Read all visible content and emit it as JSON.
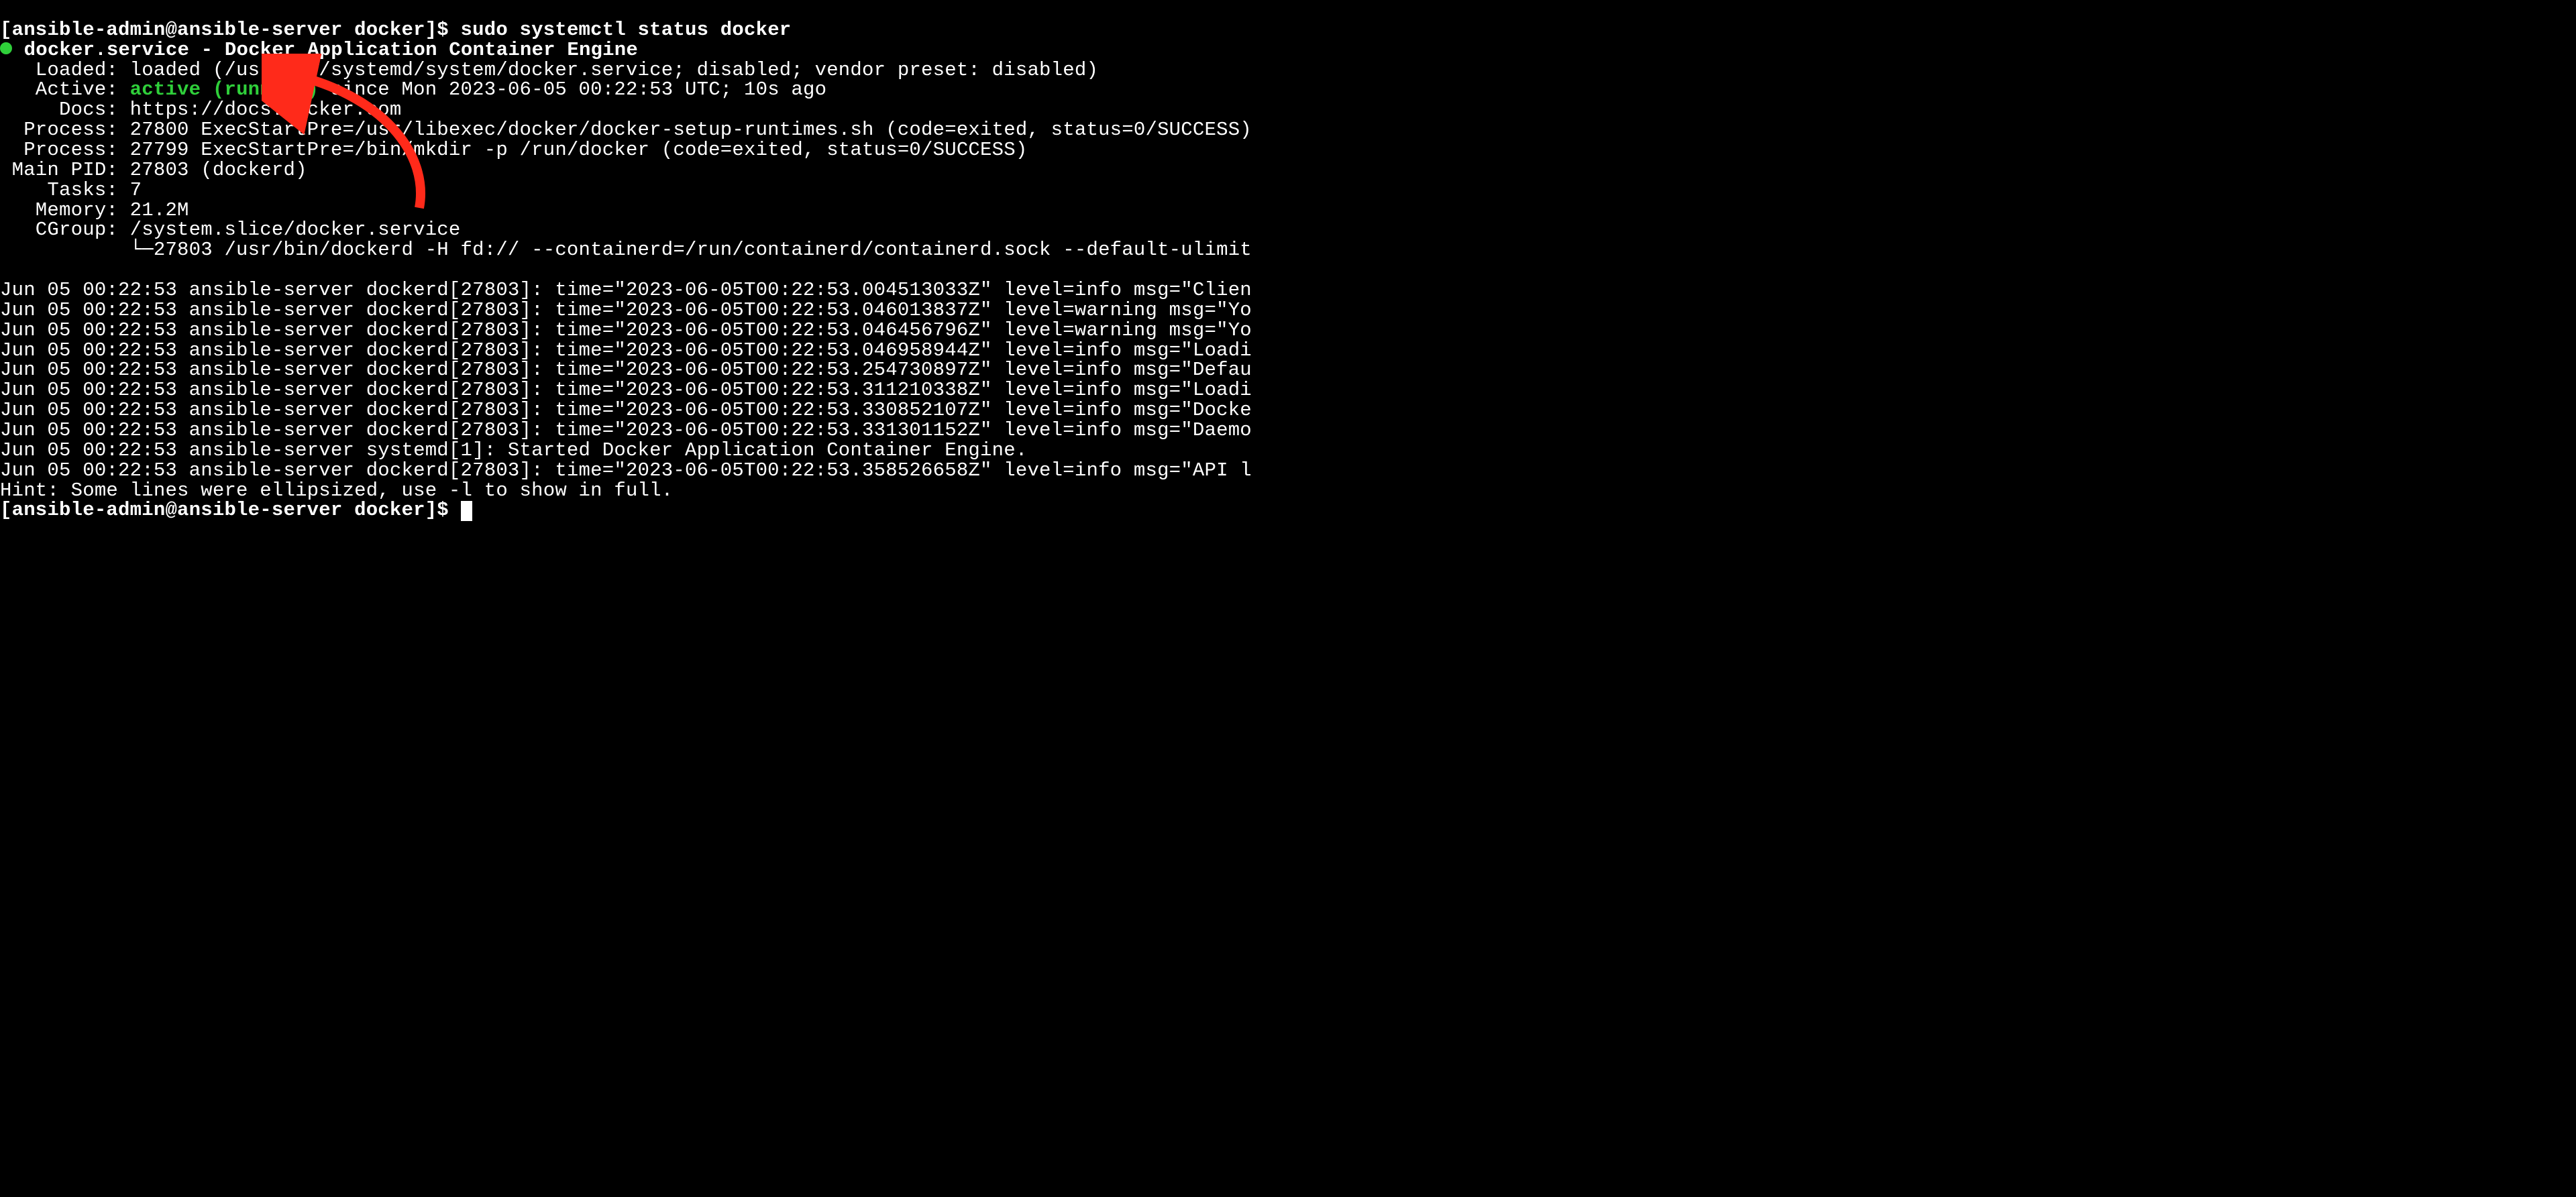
{
  "prompt1": "[ansible-admin@ansible-server docker]$ ",
  "cmd1": "sudo systemctl status docker",
  "dot_gap": " ",
  "service_header": "docker.service - Docker Application Container Engine",
  "loaded": "   Loaded: loaded (/usr/lib/systemd/system/docker.service; disabled; vendor preset: disabled)",
  "active_prefix": "   Active: ",
  "active_status": "active (running)",
  "active_suffix": " since Mon 2023-06-05 00:22:53 UTC; 10s ago",
  "docs": "     Docs: https://docs.docker.com",
  "proc1": "  Process: 27800 ExecStartPre=/usr/libexec/docker/docker-setup-runtimes.sh (code=exited, status=0/SUCCESS)",
  "proc2": "  Process: 27799 ExecStartPre=/bin/mkdir -p /run/docker (code=exited, status=0/SUCCESS)",
  "mainpid": " Main PID: 27803 (dockerd)",
  "tasks": "    Tasks: 7",
  "memory": "   Memory: 21.2M",
  "cgroup": "   CGroup: /system.slice/docker.service",
  "cgroup2": "           └─27803 /usr/bin/dockerd -H fd:// --containerd=/run/containerd/containerd.sock --default-ulimit",
  "blank": "",
  "log1": "Jun 05 00:22:53 ansible-server dockerd[27803]: time=\"2023-06-05T00:22:53.004513033Z\" level=info msg=\"Clien",
  "log2": "Jun 05 00:22:53 ansible-server dockerd[27803]: time=\"2023-06-05T00:22:53.046013837Z\" level=warning msg=\"Yo",
  "log3": "Jun 05 00:22:53 ansible-server dockerd[27803]: time=\"2023-06-05T00:22:53.046456796Z\" level=warning msg=\"Yo",
  "log4": "Jun 05 00:22:53 ansible-server dockerd[27803]: time=\"2023-06-05T00:22:53.046958944Z\" level=info msg=\"Loadi",
  "log5": "Jun 05 00:22:53 ansible-server dockerd[27803]: time=\"2023-06-05T00:22:53.254730897Z\" level=info msg=\"Defau",
  "log6": "Jun 05 00:22:53 ansible-server dockerd[27803]: time=\"2023-06-05T00:22:53.311210338Z\" level=info msg=\"Loadi",
  "log7": "Jun 05 00:22:53 ansible-server dockerd[27803]: time=\"2023-06-05T00:22:53.330852107Z\" level=info msg=\"Docke",
  "log8": "Jun 05 00:22:53 ansible-server dockerd[27803]: time=\"2023-06-05T00:22:53.331301152Z\" level=info msg=\"Daemo",
  "log9": "Jun 05 00:22:53 ansible-server systemd[1]: Started Docker Application Container Engine.",
  "log10": "Jun 05 00:22:53 ansible-server dockerd[27803]: time=\"2023-06-05T00:22:53.358526658Z\" level=info msg=\"API l",
  "hint": "Hint: Some lines were ellipsized, use -l to show in full.",
  "prompt2": "[ansible-admin@ansible-server docker]$ "
}
